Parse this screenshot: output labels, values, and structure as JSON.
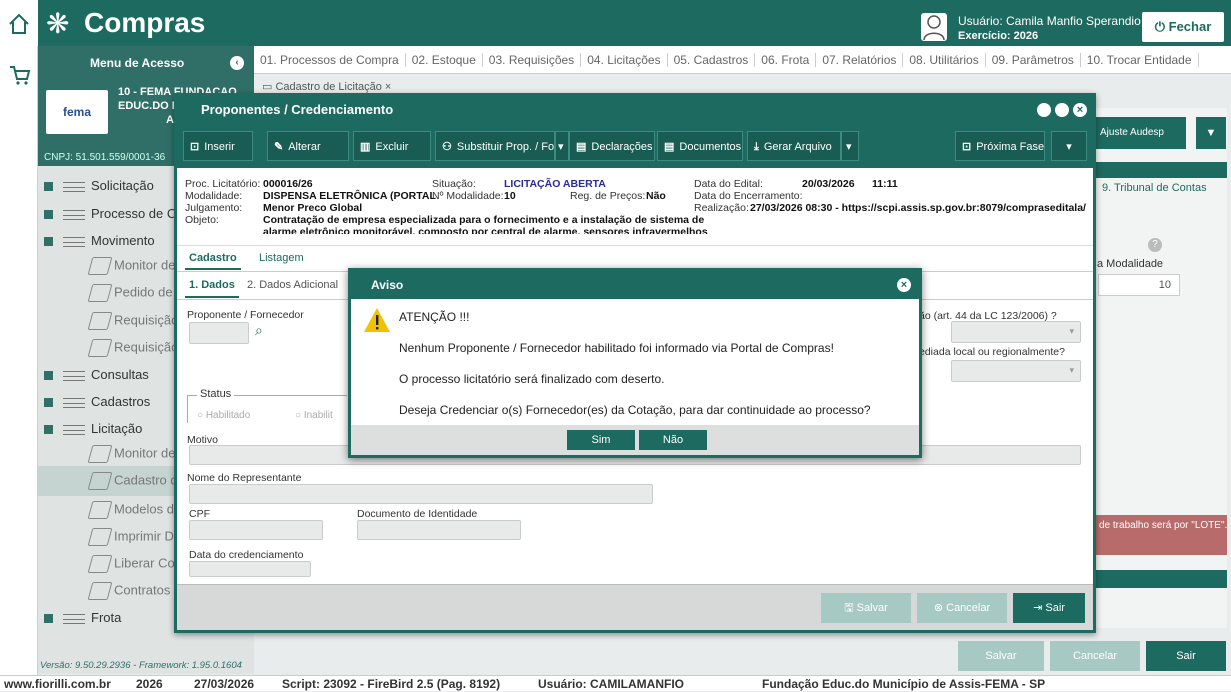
{
  "app": {
    "title": "Compras",
    "user_label": "Usuário: Camila Manfio Sperandio",
    "exercise_label": "Exercício: 2026",
    "close_label": "Fechar"
  },
  "sidebar": {
    "header": "Menu de Acesso",
    "entity_line1": "10 - FEMA FUNDACAO",
    "entity_line2": "EDUC.DO M",
    "entity_line3": "A",
    "logo_text": "fema",
    "cnpj": "CNPJ: 51.501.559/0001-36",
    "version": "Versão: 9.50.29.2936 - Framework: 1.95.0.1604",
    "items": [
      {
        "label": "Solicitação"
      },
      {
        "label": "Processo de Co"
      },
      {
        "label": "Movimento"
      },
      {
        "label": "Monitor de"
      },
      {
        "label": "Pedido de"
      },
      {
        "label": "Requisição"
      },
      {
        "label": "Requisição"
      },
      {
        "label": "Consultas"
      },
      {
        "label": "Cadastros"
      },
      {
        "label": "Licitação"
      },
      {
        "label": "Monitor de"
      },
      {
        "label": "Cadastro d"
      },
      {
        "label": "Modelos de"
      },
      {
        "label": "Imprimir Do"
      },
      {
        "label": "Liberar Con"
      },
      {
        "label": "Contratos"
      },
      {
        "label": "Frota"
      }
    ]
  },
  "menu": {
    "items": [
      "01. Processos de Compra",
      "02. Estoque",
      "03. Requisições",
      "04. Licitações",
      "05. Cadastros",
      "06. Frota",
      "07. Relatórios",
      "08. Utilitários",
      "09. Parâmetros",
      "10. Trocar Entidade"
    ],
    "doc_tab": "Cadastro de Licitação"
  },
  "background": {
    "ajuste_audesp": "Ajuste Audesp",
    "tribunal_tab": "9. Tribunal de Contas",
    "modalidade_label": "a Modalidade",
    "modalidade_value": "10",
    "lote_text": "de trabalho será por \"LOTE\".",
    "save_label": "Salvar",
    "cancel_label": "Cancelar",
    "exit_label": "Sair"
  },
  "modal": {
    "title": "Proponentes / Credenciamento",
    "toolbar": {
      "inserir": "Inserir",
      "alterar": "Alterar",
      "excluir": "Excluir",
      "substituir": "Substituir Prop. / For",
      "declaracoes": "Declarações",
      "documentos": "Documentos",
      "gerar": "Gerar Arquivo",
      "proxima": "Próxima Fase"
    },
    "info": {
      "proc_label": "Proc. Licitatório:",
      "proc_value": "000016/26",
      "modalidade_label": "Modalidade:",
      "modalidade_value": "DISPENSA ELETRÔNICA (PORTAL",
      "julgamento_label": "Julgamento:",
      "julgamento_value": "Menor Preco Global",
      "objeto_label": "Objeto:",
      "objeto_line1": "Contratação de empresa especializada para o fornecimento e a instalação de sistema de",
      "objeto_line2": "alarme eletrônico monitorável, composto por central de alarme, sensores infravermelhos",
      "situacao_label": "Situação:",
      "situacao_value": "LICITAÇÃO ABERTA",
      "nmod_label": "Nº Modalidade:",
      "nmod_value": "10",
      "regprecos_label": "Reg. de Preços:",
      "regprecos_value": "Não",
      "edital_label": "Data do Edital:",
      "edital_date": "20/03/2026",
      "edital_time": "11:11",
      "encerramento_label": "Data do Encerramento:",
      "realizacao_label": "Realização:",
      "realizacao_value": "27/03/2026 08:30 - https://scpi.assis.sp.gov.br:8079/compraseditala/"
    },
    "tabs": [
      "Cadastro",
      "Listagem"
    ],
    "subtabs": [
      "1. Dados",
      "2. Dados Adicional"
    ],
    "form": {
      "proponente_label": "Proponente / Fornecedor",
      "lc_label": "ão (art. 44 da LC 123/2006) ?",
      "sediada_label": "ediada local ou regionalmente?",
      "status_label": "Status",
      "habilitado": "Habilitado",
      "inabilitado": "Inabilit",
      "motivo_label": "Motivo",
      "representante_label": "Nome do Representante",
      "cpf_label": "CPF",
      "documento_label": "Documento de Identidade",
      "data_cred_label": "Data do credenciamento"
    },
    "footer": {
      "salvar": "Salvar",
      "cancelar": "Cancelar",
      "sair": "Sair"
    }
  },
  "aviso": {
    "title": "Aviso",
    "line1": "ATENÇÃO !!!",
    "line2": "Nenhum Proponente / Fornecedor habilitado foi informado via Portal de Compras!",
    "line3": "O processo licitatório será finalizado com deserto.",
    "line4": "Deseja Credenciar o(s) Fornecedor(es) da Cotação, para dar continuidade ao processo?",
    "yes": "Sim",
    "no": "Não"
  },
  "statusbar": {
    "site": "www.fiorilli.com.br",
    "year": "2026",
    "date": "27/03/2026",
    "script": "Script: 23092 - FireBird 2.5 (Pag. 8192)",
    "user": "Usuário: CAMILAMANFIO",
    "entity": "Fundação Educ.do Município de Assis-FEMA - SP"
  },
  "colors": {
    "primary": "#1d6a60",
    "warning": "#f2c200",
    "danger": "#b86b6b"
  }
}
